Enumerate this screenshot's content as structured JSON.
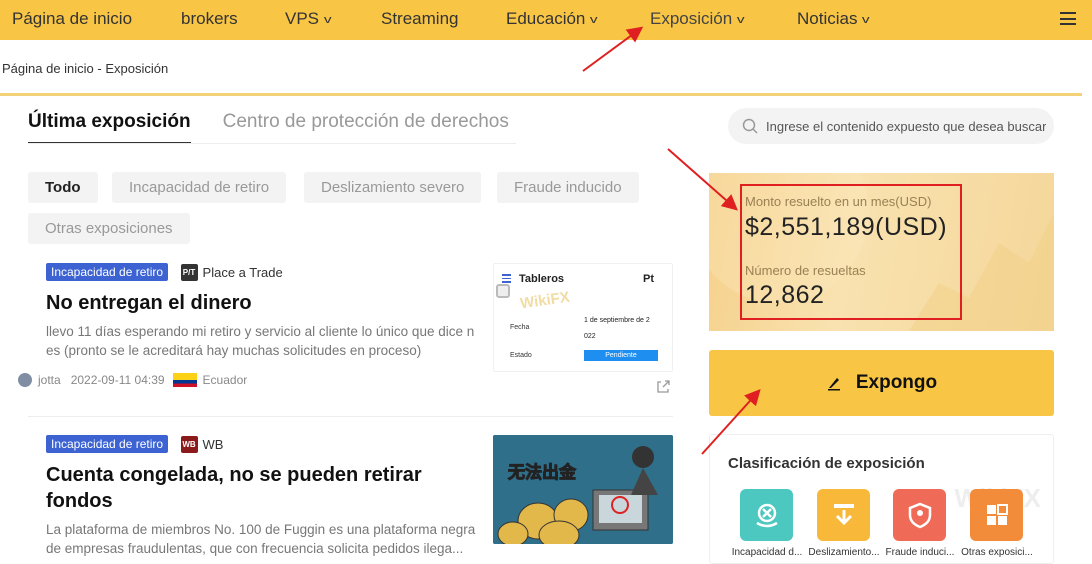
{
  "nav": {
    "items": [
      {
        "label": "Página de inicio",
        "chevron": false
      },
      {
        "label": "brokers",
        "chevron": false
      },
      {
        "label": "VPS",
        "chevron": true
      },
      {
        "label": "Streaming",
        "chevron": false
      },
      {
        "label": "Educación",
        "chevron": true
      },
      {
        "label": "Exposición",
        "chevron": true
      },
      {
        "label": "Noticias",
        "chevron": true
      }
    ],
    "chevron_glyph": "v",
    "menu_icon": "hamburger-icon"
  },
  "breadcrumb": "Página de inicio - Exposición",
  "tabs": [
    {
      "label": "Última exposición",
      "active": true
    },
    {
      "label": "Centro de protección de derechos",
      "active": false
    }
  ],
  "filters": [
    "Todo",
    "Incapacidad de retiro",
    "Deslizamiento severo",
    "Fraude inducido",
    "Otras exposiciones"
  ],
  "search": {
    "placeholder": "Ingrese el contenido expuesto que desea buscar"
  },
  "articles": [
    {
      "tag": "Incapacidad de retiro",
      "broker": "Place a Trade",
      "broker_logo_text": "P/T",
      "title": "No entregan el dinero",
      "excerpt": "llevo 11 días esperando mi retiro y servicio al cliente lo único que dice n es (pronto se le acreditará hay muchas solicitudes en proceso)",
      "user": "jotta",
      "date": "2022-09-11 04:39",
      "country": "Ecuador",
      "thumb": {
        "heading": "Tableros",
        "logo": "Pt",
        "watermark": "WikiFX",
        "row1_label": "Fecha",
        "row1_value_a": "1 de septiembre de 2",
        "row1_value_b": "022",
        "row2_label": "Estado",
        "row2_value": "Pendiente"
      }
    },
    {
      "tag": "Incapacidad de retiro",
      "broker": "WB",
      "broker_logo_text": "WB",
      "title": "Cuenta congelada, no se pueden retirar fondos",
      "excerpt": "La plataforma de miembros No. 100 de Fuggin es una plataforma negra de empresas fraudulentas, que con frecuencia solicita pedidos ilega...",
      "thumb_text": "无法出金"
    }
  ],
  "stats": {
    "resolved_amount_label": "Monto resuelto en un mes(USD)",
    "resolved_amount": "$2,551,189(USD)",
    "resolved_count_label": "Número de resueltas",
    "resolved_count": "12,862"
  },
  "expose_button": "Expongo",
  "classification": {
    "title": "Clasificación de exposición",
    "items": [
      {
        "label": "Incapacidad d...",
        "color": "#4cc8c0",
        "icon": "withdraw-block-icon"
      },
      {
        "label": "Deslizamiento...",
        "color": "#f8b93a",
        "icon": "slippage-down-icon"
      },
      {
        "label": "Fraude induci...",
        "color": "#f06b57",
        "icon": "fraud-shield-icon"
      },
      {
        "label": "Otras exposici...",
        "color": "#f28c3b",
        "icon": "other-grid-icon"
      }
    ],
    "watermark": "WikiFX"
  },
  "colors": {
    "nav_bg": "#f8c545",
    "tag_blue": "#3c63d1",
    "annotation_red": "#e02020"
  }
}
